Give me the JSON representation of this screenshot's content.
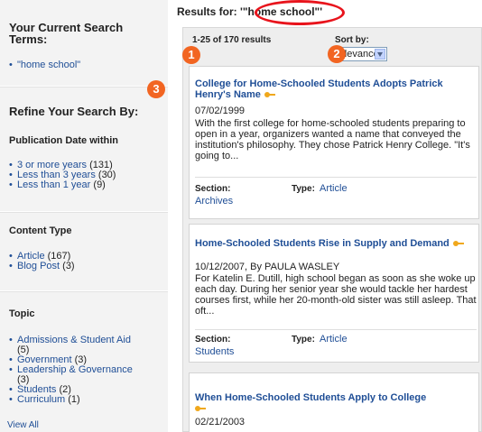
{
  "sidebar": {
    "search_terms_title": "Your Current Search Terms:",
    "search_terms": [
      "\"home school\""
    ],
    "refine_title": "Refine Your Search By:",
    "publication_date": {
      "title": "Publication Date within",
      "items": [
        {
          "label": "3 or more years",
          "count": "(131)"
        },
        {
          "label": "Less than 3 years",
          "count": "(30)"
        },
        {
          "label": "Less than 1 year",
          "count": "(9)"
        }
      ]
    },
    "content_type": {
      "title": "Content Type",
      "items": [
        {
          "label": "Article",
          "count": "(167)"
        },
        {
          "label": "Blog Post",
          "count": "(3)"
        }
      ]
    },
    "topic": {
      "title": "Topic",
      "items": [
        {
          "label": "Admissions & Student Aid",
          "count": "(5)"
        },
        {
          "label": "Government",
          "count": "(3)"
        },
        {
          "label": "Leadership & Governance",
          "count": "(3)"
        },
        {
          "label": "Students",
          "count": "(2)"
        },
        {
          "label": "Curriculum",
          "count": "(1)"
        }
      ],
      "view_all": "View All"
    }
  },
  "badges": {
    "one": "1",
    "two": "2",
    "three": "3"
  },
  "main": {
    "results_title": "Results for: '\"home school\"'",
    "count_text": "1-25 of 170 results",
    "sort_label": "Sort by:",
    "sort_value": "relevance",
    "results": [
      {
        "title": "College for Home-Schooled Students Adopts Patrick Henry's Name",
        "meta": "07/02/1999",
        "snippet": "With the first college for home-schooled students preparing to open in a year, organizers wanted a name that conveyed the institution's philosophy. They chose Patrick Henry College. \"It's going to...",
        "section_label": "Section:",
        "section_value": "Archives",
        "type_label": "Type:",
        "type_value": "Article"
      },
      {
        "title": "Home-Schooled Students Rise in Supply and Demand",
        "meta": "10/12/2007, By PAULA WASLEY",
        "snippet": "For Katelin E. Dutill, high school began as soon as she woke up each day. During her senior year she would tackle her hardest courses first, while her 20-month-old sister was still asleep. That oft...",
        "section_label": "Section:",
        "section_value": "Students",
        "type_label": "Type:",
        "type_value": "Article"
      },
      {
        "title": "When Home-Schooled Students Apply to College",
        "meta": "02/21/2003"
      }
    ]
  },
  "colors": {
    "accent_orange": "#f26522",
    "link_blue": "#1f4e96",
    "highlight_red": "#e8141c"
  }
}
